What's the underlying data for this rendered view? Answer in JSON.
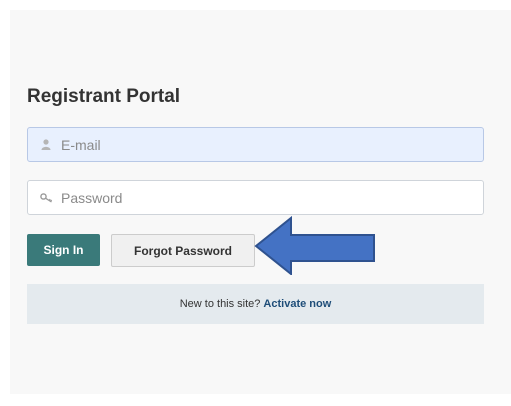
{
  "portal": {
    "title": "Registrant Portal"
  },
  "email_field": {
    "placeholder": "E-mail",
    "value": "",
    "icon": "user-icon"
  },
  "password_field": {
    "placeholder": "Password",
    "value": "",
    "icon": "key-icon"
  },
  "buttons": {
    "sign_in": "Sign In",
    "forgot_password": "Forgot Password"
  },
  "register": {
    "prompt": "New to this site?",
    "link": "Activate now"
  },
  "annotation": {
    "icon": "left-arrow-annotation",
    "color": "#4472c4"
  },
  "colors": {
    "primary_button": "#3a7a7a",
    "email_field_bg": "#e8f0fe",
    "register_bar_bg": "#e4eaee",
    "link": "#1f4e79"
  }
}
